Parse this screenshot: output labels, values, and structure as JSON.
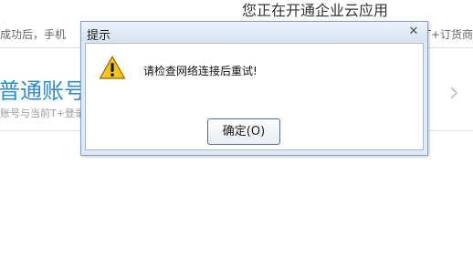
{
  "background": {
    "heading": "您正在开通企业云应用",
    "info_left": "成功后，手机",
    "info_right": "T+订货商",
    "account_title": "普通账号登",
    "account_subtitle": "账号与当前T+登录"
  },
  "dialog": {
    "title": "提示",
    "close_icon": "close-icon",
    "icon": "warning-icon",
    "message": "请检查网络连接后重试!",
    "ok_label": "确定(O)"
  },
  "colors": {
    "accent_blue": "#2b8ccf",
    "dialog_frame": "#dfe9f6",
    "warning_yellow": "#f5c518"
  }
}
